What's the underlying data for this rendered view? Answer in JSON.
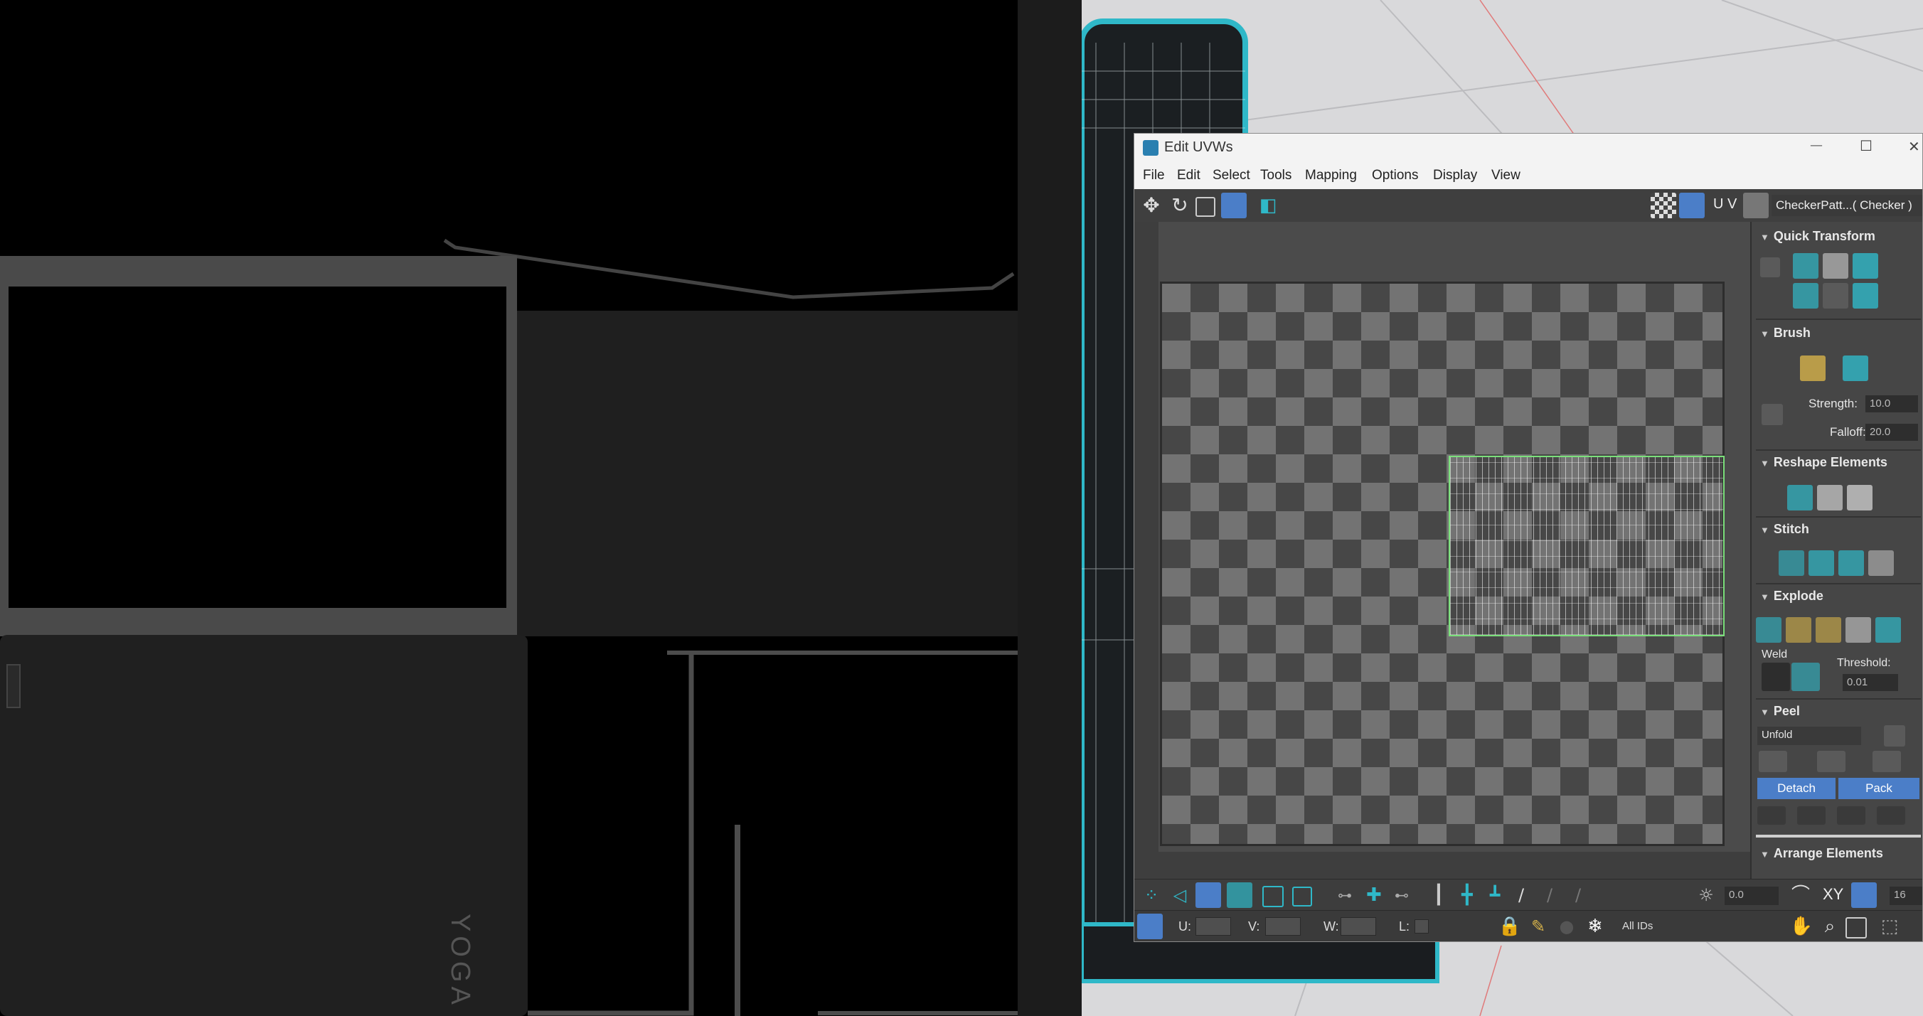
{
  "window": {
    "title": "Edit UVWs",
    "controls": {
      "minimize": "—",
      "maximize": "☐",
      "close": "✕"
    }
  },
  "menu": [
    "File",
    "Edit",
    "Select",
    "Tools",
    "Mapping",
    "Options",
    "Display",
    "View"
  ],
  "toolbar_top": {
    "uv_label": "U V",
    "texture_dropdown": "CheckerPatt...( Checker )"
  },
  "texture_preview": {
    "logo_text": "YOGA"
  },
  "rollouts": {
    "quick_transform": "Quick Transform",
    "brush": "Brush",
    "strength_label": "Strength:",
    "strength_value": "10.0",
    "falloff_label": "Falloff:",
    "falloff_value": "20.0",
    "reshape": "Reshape Elements",
    "stitch": "Stitch",
    "explode": "Explode",
    "weld_label": "Weld",
    "threshold_label": "Threshold:",
    "threshold_value": "0.01",
    "peel": "Peel",
    "peel_mode": "Unfold",
    "detach": "Detach",
    "pack": "Pack",
    "arrange": "Arrange Elements"
  },
  "toolbar_bottom": {
    "angle_value": "0.0",
    "xy_label": "XY",
    "grid_value": "16"
  },
  "status": {
    "u_label": "U:",
    "v_label": "V:",
    "w_label": "W:",
    "l_label": "L:",
    "ids_dropdown": "All IDs"
  },
  "colors": {
    "accent_cyan": "#2fb8c8",
    "selection_green": "#7be07b",
    "blue_button": "#4b7ec8",
    "checker_dark": "#474747",
    "checker_light": "#737373"
  }
}
